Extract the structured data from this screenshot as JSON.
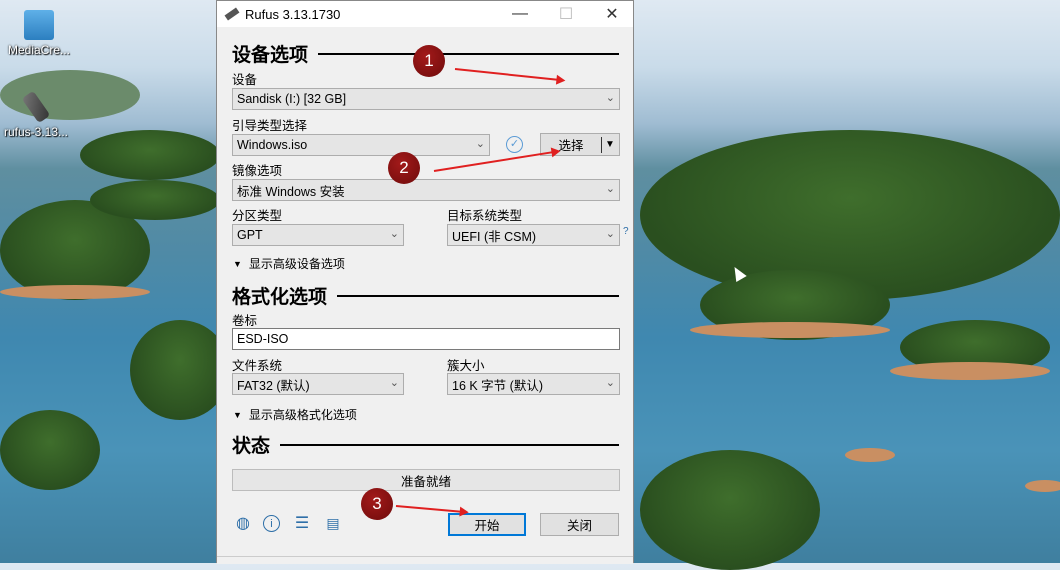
{
  "desktop": {
    "icons": [
      {
        "label": "MediaCre..."
      },
      {
        "label": "rufus-3.13..."
      }
    ]
  },
  "window": {
    "title": "Rufus 3.13.1730",
    "minimize": "—",
    "maximize": "☐",
    "close": "✕"
  },
  "device_options": {
    "heading": "设备选项",
    "device_label": "设备",
    "device_value": "Sandisk  (I:) [32 GB]",
    "boot_label": "引导类型选择",
    "boot_value": "Windows.iso",
    "select_button": "选择",
    "image_label": "镜像选项",
    "image_value": "标准 Windows 安装",
    "partition_label": "分区类型",
    "partition_value": "GPT",
    "target_label": "目标系统类型",
    "target_value": "UEFI (非 CSM)",
    "help": "?",
    "advanced": "显示高级设备选项"
  },
  "format_options": {
    "heading": "格式化选项",
    "volume_label": "卷标",
    "volume_value": "ESD-ISO",
    "fs_label": "文件系统",
    "fs_value": "FAT32 (默认)",
    "cluster_label": "簇大小",
    "cluster_value": "16 K 字节 (默认)",
    "advanced": "显示高级格式化选项"
  },
  "status": {
    "heading": "状态",
    "progress_text": "准备就绪",
    "progress": 0
  },
  "buttons": {
    "start": "开始",
    "close": "关闭"
  },
  "annotations": [
    "1",
    "2",
    "3"
  ]
}
